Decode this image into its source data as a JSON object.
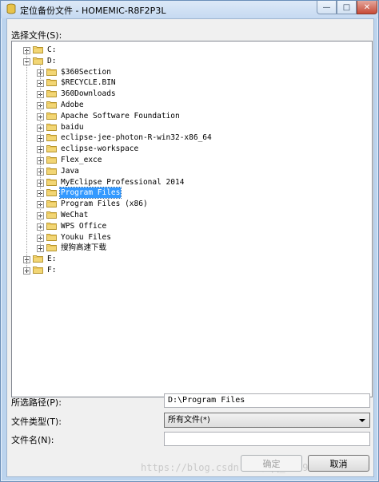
{
  "window": {
    "title": "定位备份文件 - HOMEMIC-R8F2P3L"
  },
  "labels": {
    "select_file": "选择文件(S):",
    "selected_path": "所选路径(P):",
    "file_type": "文件类型(T):",
    "file_name": "文件名(N):"
  },
  "tree": {
    "drives": [
      {
        "label": "C:"
      },
      {
        "label": "D:"
      },
      {
        "label": "E:"
      },
      {
        "label": "F:"
      }
    ],
    "d_children": [
      {
        "label": "$360Section"
      },
      {
        "label": "$RECYCLE.BIN"
      },
      {
        "label": "360Downloads"
      },
      {
        "label": "Adobe"
      },
      {
        "label": "Apache Software Foundation"
      },
      {
        "label": "baidu"
      },
      {
        "label": "eclipse-jee-photon-R-win32-x86_64"
      },
      {
        "label": "eclipse-workspace"
      },
      {
        "label": "Flex_exce"
      },
      {
        "label": "Java"
      },
      {
        "label": "MyEclipse Professional 2014"
      },
      {
        "label": "Program Files"
      },
      {
        "label": "Program Files (x86)"
      },
      {
        "label": "WeChat"
      },
      {
        "label": "WPS Office"
      },
      {
        "label": "Youku Files"
      },
      {
        "label": "搜狗高速下载"
      }
    ],
    "selected": "Program Files"
  },
  "fields": {
    "selected_path_value": "D:\\Program Files",
    "file_type_value": "所有文件(*)",
    "file_name_value": ""
  },
  "buttons": {
    "ok": "确定",
    "cancel": "取消"
  },
  "watermark": "https://blog.csdn.net/qq_43499035"
}
